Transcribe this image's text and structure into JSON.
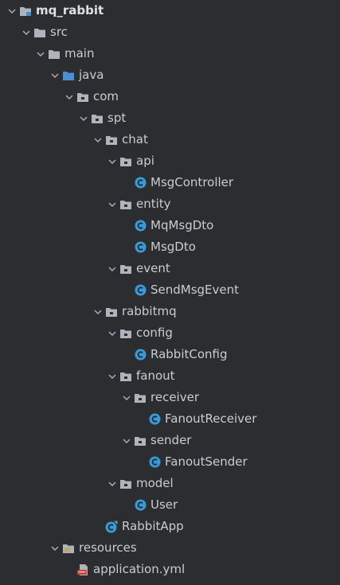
{
  "colors": {
    "background": "#2b2d30",
    "text": "#c9ccd2",
    "folder": "#aeb3bc",
    "source_folder": "#4a8fd4",
    "class_badge": "#3a9ad9",
    "chevron": "#a8adb5"
  },
  "tree": [
    {
      "label": "mq_rabbit",
      "icon": "module-folder-icon",
      "expanded": true,
      "bold": true
    },
    {
      "label": "src",
      "icon": "folder-icon",
      "expanded": true
    },
    {
      "label": "main",
      "icon": "folder-icon",
      "expanded": true
    },
    {
      "label": "java",
      "icon": "source-folder-icon",
      "expanded": true
    },
    {
      "label": "com",
      "icon": "package-icon",
      "expanded": true
    },
    {
      "label": "spt",
      "icon": "package-icon",
      "expanded": true
    },
    {
      "label": "chat",
      "icon": "package-icon",
      "expanded": true
    },
    {
      "label": "api",
      "icon": "package-icon",
      "expanded": true
    },
    {
      "label": "MsgController",
      "icon": "class-icon"
    },
    {
      "label": "entity",
      "icon": "package-icon",
      "expanded": true
    },
    {
      "label": "MqMsgDto",
      "icon": "class-icon"
    },
    {
      "label": "MsgDto",
      "icon": "class-icon"
    },
    {
      "label": "event",
      "icon": "package-icon",
      "expanded": true
    },
    {
      "label": "SendMsgEvent",
      "icon": "class-icon"
    },
    {
      "label": "rabbitmq",
      "icon": "package-icon",
      "expanded": true
    },
    {
      "label": "config",
      "icon": "package-icon",
      "expanded": true
    },
    {
      "label": "RabbitConfig",
      "icon": "class-icon"
    },
    {
      "label": "fanout",
      "icon": "package-icon",
      "expanded": true
    },
    {
      "label": "receiver",
      "icon": "package-icon",
      "expanded": true
    },
    {
      "label": "FanoutReceiver",
      "icon": "class-icon"
    },
    {
      "label": "sender",
      "icon": "package-icon",
      "expanded": true
    },
    {
      "label": "FanoutSender",
      "icon": "class-icon"
    },
    {
      "label": "model",
      "icon": "package-icon",
      "expanded": true
    },
    {
      "label": "User",
      "icon": "class-icon"
    },
    {
      "label": "RabbitApp",
      "icon": "spring-boot-class-icon"
    },
    {
      "label": "resources",
      "icon": "resources-folder-icon",
      "expanded": true
    },
    {
      "label": "application.yml",
      "icon": "yml-file-icon"
    }
  ]
}
